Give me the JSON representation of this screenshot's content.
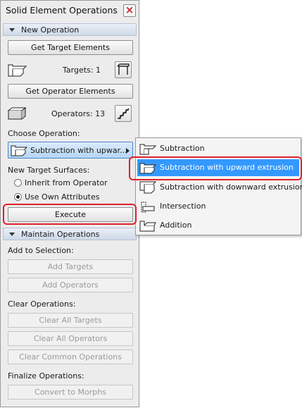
{
  "window": {
    "title": "Solid Element Operations"
  },
  "new_operation": {
    "header": "New Operation",
    "get_target_label": "Get Target Elements",
    "targets_label": "Targets: 1",
    "get_operator_label": "Get Operator Elements",
    "operators_label": "Operators: 13",
    "choose_operation_label": "Choose Operation:",
    "selected_operation": "Subtraction with upwar...",
    "new_target_surfaces_label": "New Target Surfaces:",
    "radio_options": [
      {
        "label": "Inherit from Operator",
        "checked": false
      },
      {
        "label": "Use Own Attributes",
        "checked": true
      }
    ],
    "execute_label": "Execute"
  },
  "maintain_operations": {
    "header": "Maintain Operations",
    "add_to_selection_label": "Add to Selection:",
    "add_targets_label": "Add Targets",
    "add_operators_label": "Add Operators",
    "clear_operations_label": "Clear Operations:",
    "clear_all_targets_label": "Clear All Targets",
    "clear_all_operators_label": "Clear All Operators",
    "clear_common_label": "Clear Common Operations",
    "finalize_label": "Finalize Operations:",
    "convert_label": "Convert to Morphs"
  },
  "operation_menu": {
    "items": [
      {
        "label": "Subtraction",
        "icon": "subtraction-icon",
        "selected": false
      },
      {
        "label": "Subtraction with upward extrusion",
        "icon": "subtraction-upward-icon",
        "selected": true
      },
      {
        "label": "Subtraction with downward extrusion",
        "icon": "subtraction-downward-icon",
        "selected": false
      },
      {
        "label": "Intersection",
        "icon": "intersection-icon",
        "selected": false
      },
      {
        "label": "Addition",
        "icon": "addition-icon",
        "selected": false
      }
    ]
  },
  "colors": {
    "highlight_red": "#e0202a",
    "menu_selected": "#3399ff",
    "section_header": "#cfd9e8"
  }
}
